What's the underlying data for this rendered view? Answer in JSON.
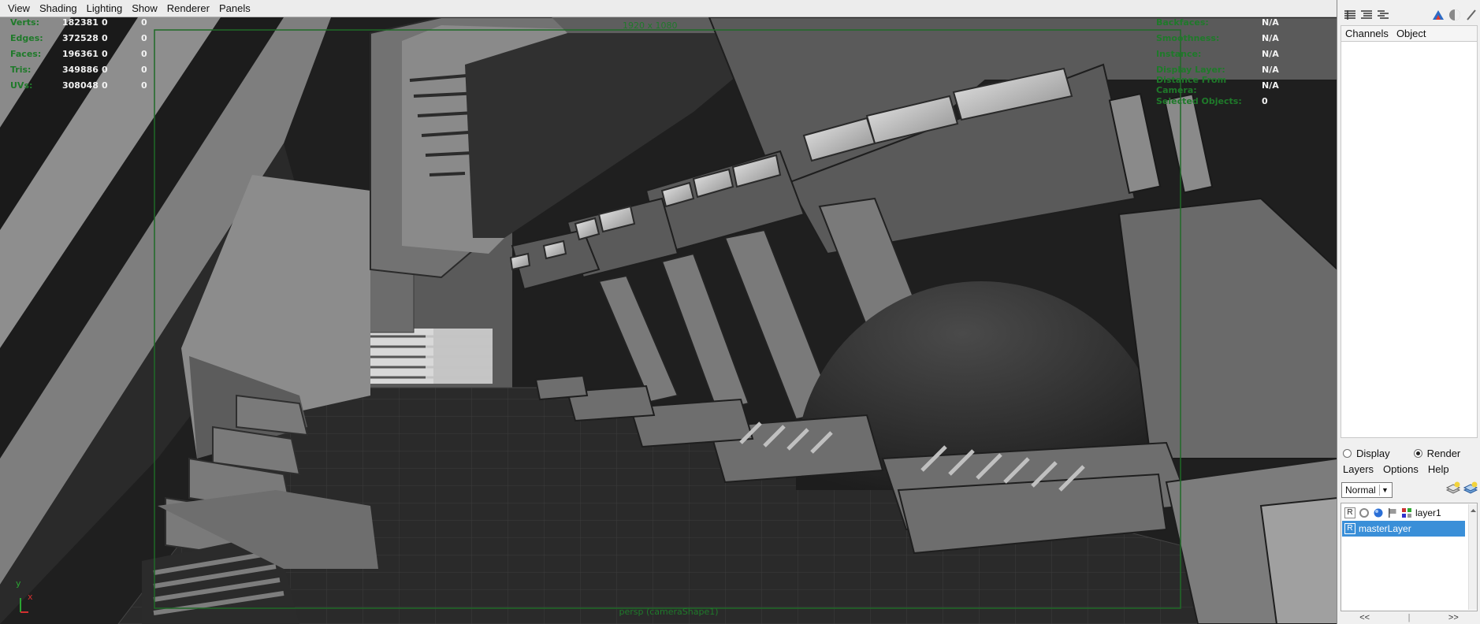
{
  "menubar": {
    "items": [
      "View",
      "Shading",
      "Lighting",
      "Show",
      "Renderer",
      "Panels"
    ]
  },
  "hud_left": [
    {
      "label": "Verts:",
      "v1": "182381",
      "v2": "0",
      "v3": "0"
    },
    {
      "label": "Edges:",
      "v1": "372528",
      "v2": "0",
      "v3": "0"
    },
    {
      "label": "Faces:",
      "v1": "196361",
      "v2": "0",
      "v3": "0"
    },
    {
      "label": "Tris:",
      "v1": "349886",
      "v2": "0",
      "v3": "0"
    },
    {
      "label": "UVs:",
      "v1": "308048",
      "v2": "0",
      "v3": "0"
    }
  ],
  "hud_right": [
    {
      "label": "Backfaces:",
      "value": "N/A"
    },
    {
      "label": "Smoothness:",
      "value": "N/A"
    },
    {
      "label": "Instance:",
      "value": "N/A"
    },
    {
      "label": "Display Layer:",
      "value": "N/A"
    },
    {
      "label": "Distance From Camera:",
      "value": "N/A"
    },
    {
      "label": "Selected Objects:",
      "value": "0"
    }
  ],
  "viewport": {
    "resolution": "1920 x 1080",
    "camera": "persp (cameraShape1)"
  },
  "axis": {
    "y": "y",
    "x": "x"
  },
  "colors": {
    "hud_green": "#1f7a2a",
    "selection_blue": "#3a8fd8"
  },
  "channel_box": {
    "tabs": [
      "Channels",
      "Object"
    ]
  },
  "layer_editor": {
    "mode_display": "Display",
    "mode_render": "Render",
    "menu": [
      "Layers",
      "Options",
      "Help"
    ],
    "blend_mode": "Normal",
    "layers": [
      {
        "r": "R",
        "name": "layer1"
      },
      {
        "r": "R",
        "name": "masterLayer"
      }
    ]
  },
  "bottom_nav": {
    "prev": "<<",
    "next": ">>"
  },
  "icons": [
    "channel-box-toggle-icon",
    "attribute-editor-toggle-icon",
    "tool-settings-toggle-icon",
    "render-icon",
    "shading-ball-icon",
    "paint-brush-icon",
    "new-layer-icon",
    "new-layer-selected-icon"
  ]
}
